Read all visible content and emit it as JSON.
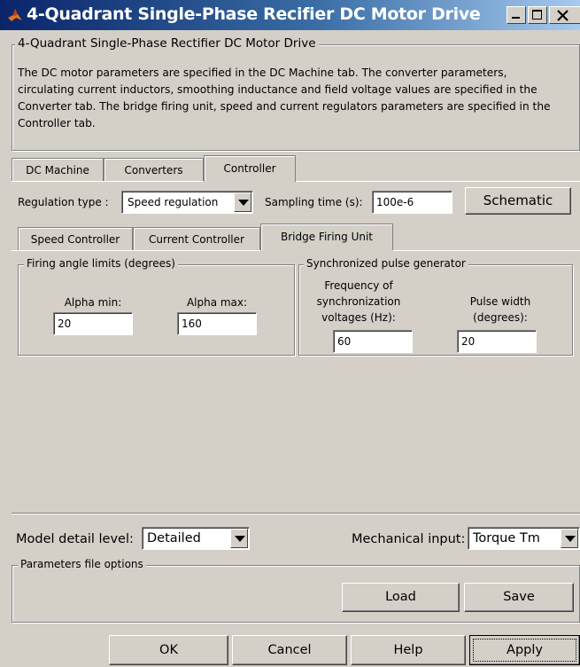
{
  "window": {
    "title": "4-Quadrant Single-Phase Recifier DC Motor Drive"
  },
  "main_group": {
    "label": "4-Quadrant Single-Phase Rectifier DC Motor Drive",
    "description_lines": [
      "The DC motor parameters are specified in the DC Machine tab. The converter parameters,",
      "circulating current inductors, smoothing inductance and field voltage values are specified in the",
      "Converter tab. The bridge firing unit, speed and current regulators parameters are specified in the",
      "Controller tab."
    ]
  },
  "tabs": [
    "DC Machine",
    "Converters",
    "Controller"
  ],
  "controller": {
    "regulation_label": "Regulation type :",
    "regulation_value": "Speed regulation",
    "sampling_label": "Sampling time (s):",
    "sampling_value": "100e-6",
    "schematic_label": "Schematic"
  },
  "subtabs": [
    "Speed Controller",
    "Current Controller",
    "Bridge Firing Unit"
  ],
  "firing": {
    "label": "Firing angle limits (degrees)",
    "alpha_min_label": "Alpha min:",
    "alpha_min_value": "20",
    "alpha_max_label": "Alpha max:",
    "alpha_max_value": "160"
  },
  "pulse": {
    "label": "Synchronized pulse generator",
    "freq_label_lines": [
      "Frequency of",
      "synchronization",
      "voltages (Hz):"
    ],
    "freq_value": "60",
    "width_label_lines": [
      "Pulse width",
      "(degrees):"
    ],
    "width_value": "20"
  },
  "bottom": {
    "detail_label": "Model detail level:",
    "detail_value": "Detailed",
    "mech_label": "Mechanical input:",
    "mech_value": "Torque Tm",
    "params_label": "Parameters file options",
    "load_label": "Load",
    "save_label": "Save"
  },
  "buttons": {
    "ok": "OK",
    "cancel": "Cancel",
    "help": "Help",
    "apply": "Apply"
  }
}
